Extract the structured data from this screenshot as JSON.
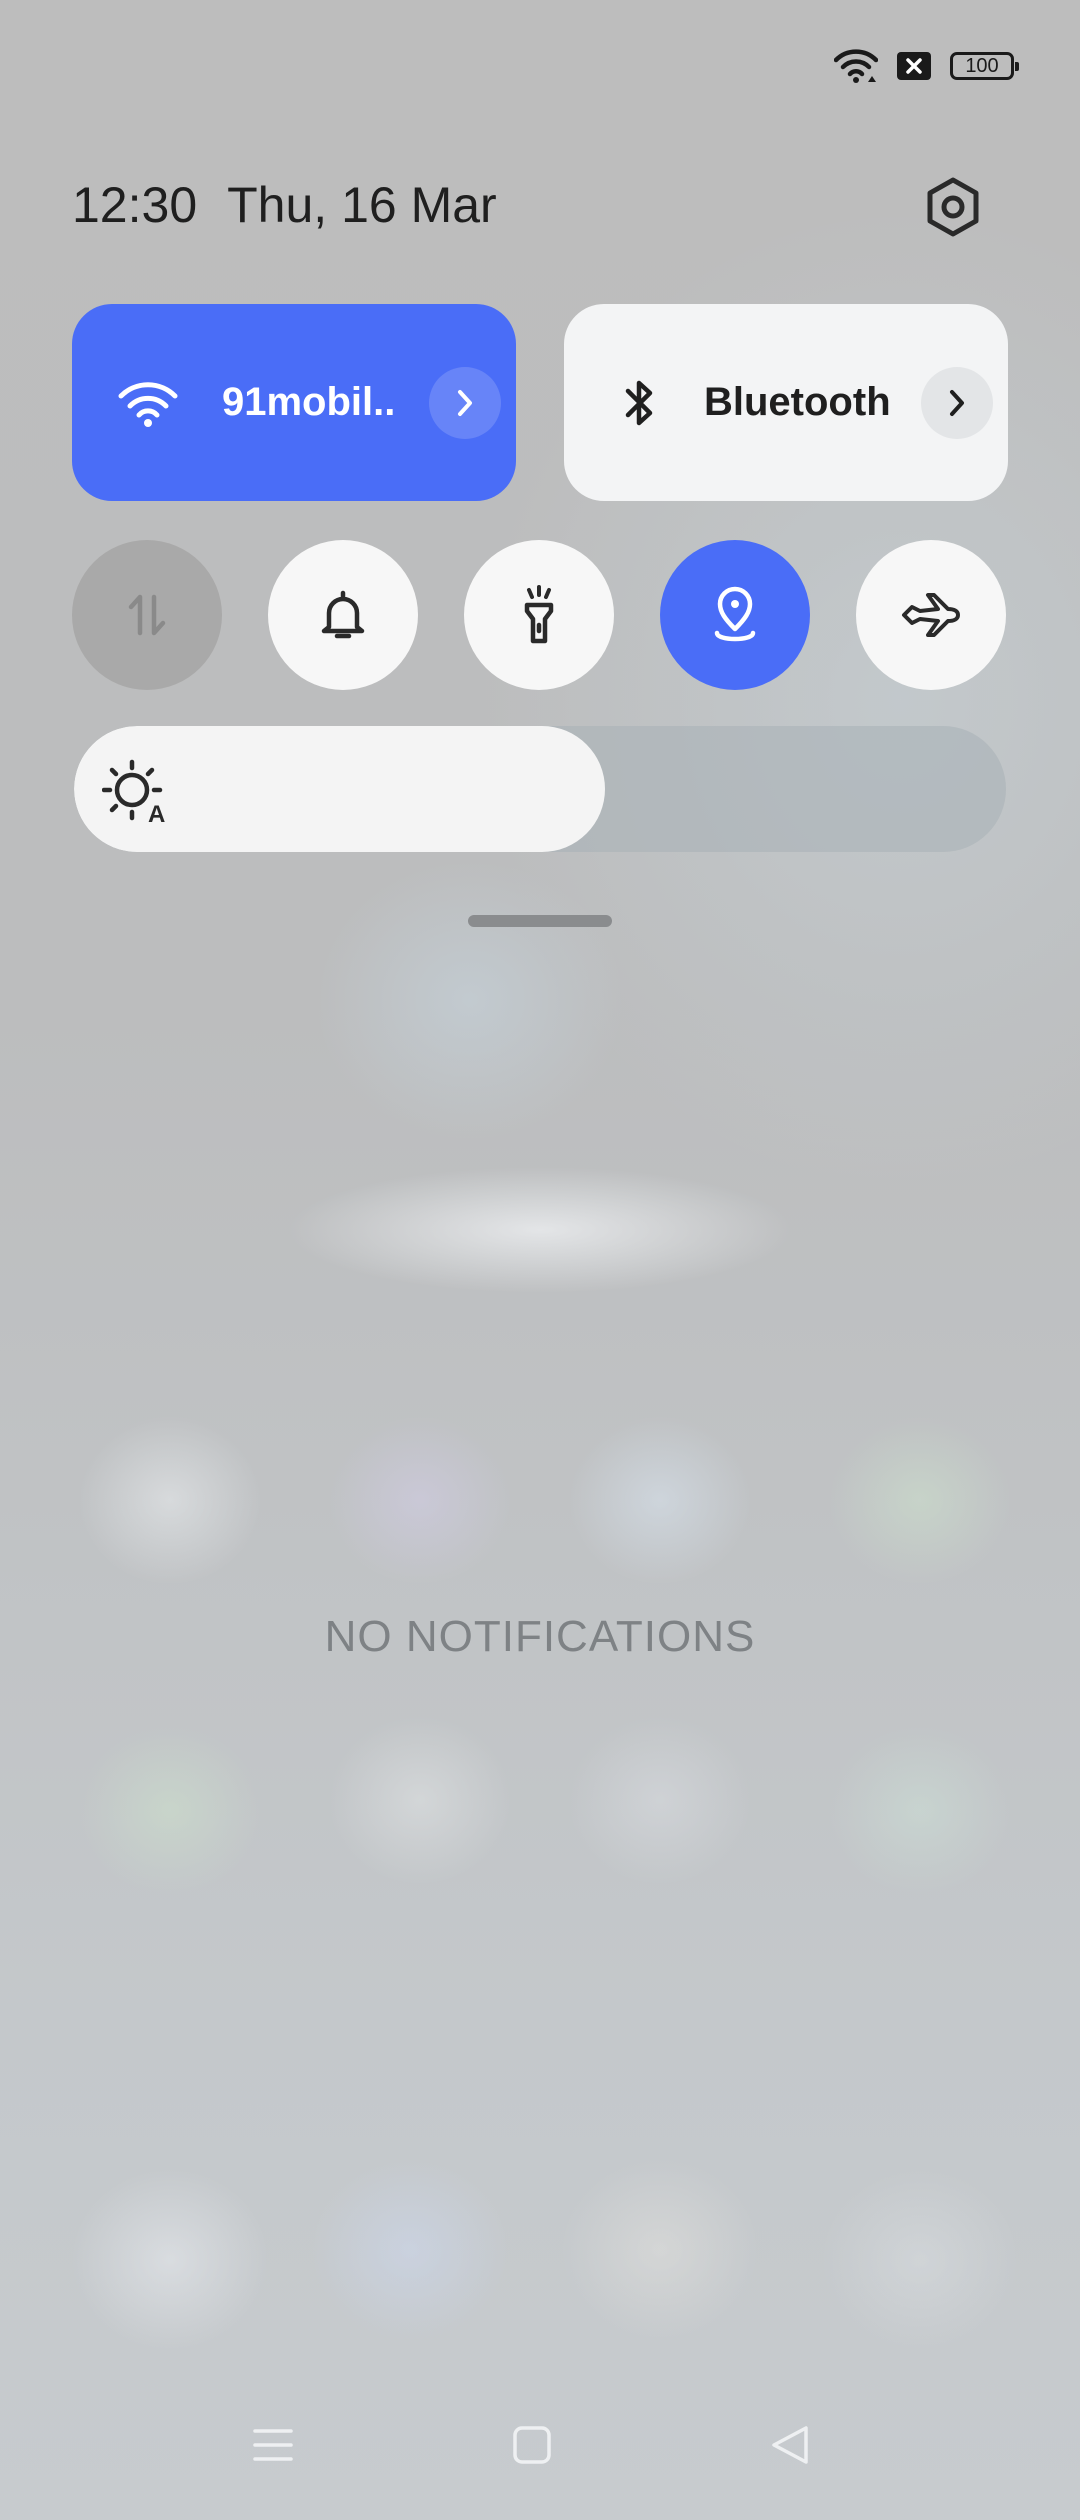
{
  "status_bar": {
    "icons": [
      "wifi-icon",
      "no-sim-icon",
      "battery-icon"
    ],
    "battery_level": "100"
  },
  "header": {
    "time": "12:30",
    "date": "Thu, 16 Mar",
    "settings_icon": "settings-hexagon-icon"
  },
  "tiles": {
    "wifi": {
      "label": "91mobil..",
      "icon": "wifi-icon",
      "active": true
    },
    "bluetooth": {
      "label": "Bluetooth",
      "icon": "bluetooth-icon",
      "active": false
    }
  },
  "toggles": [
    {
      "name": "mobile-data",
      "icon": "data-arrows-icon",
      "state": "disabled"
    },
    {
      "name": "sound",
      "icon": "bell-icon",
      "state": "off"
    },
    {
      "name": "flashlight",
      "icon": "flashlight-icon",
      "state": "off"
    },
    {
      "name": "location",
      "icon": "location-pin-icon",
      "state": "on"
    },
    {
      "name": "airplane-mode",
      "icon": "airplane-icon",
      "state": "off"
    }
  ],
  "brightness": {
    "icon": "auto-brightness-icon",
    "level": 0.57
  },
  "notifications": {
    "empty_text": "NO NOTIFICATIONS"
  },
  "nav_bar": {
    "icons": [
      "menu-icon",
      "home-icon",
      "back-icon"
    ]
  },
  "colors": {
    "accent": "#4a6df7",
    "tile_inactive": "#f3f4f5",
    "toggle_disabled": "#a9a9a9"
  }
}
